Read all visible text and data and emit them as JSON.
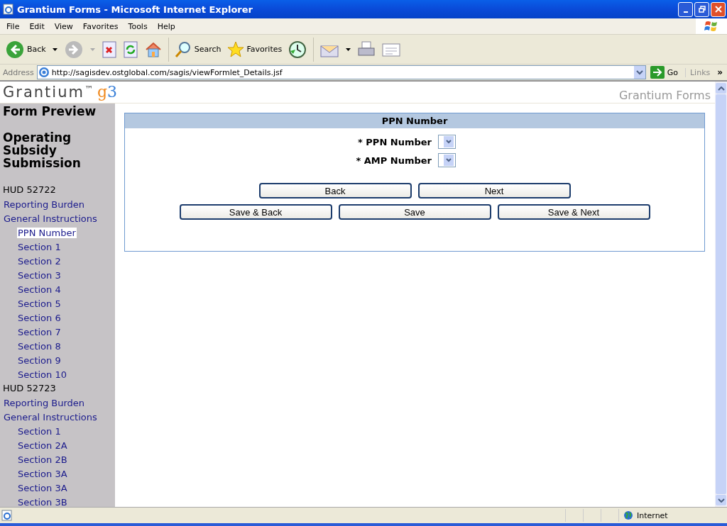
{
  "window": {
    "title": "Grantium Forms - Microsoft Internet Explorer"
  },
  "menu": [
    "File",
    "Edit",
    "View",
    "Favorites",
    "Tools",
    "Help"
  ],
  "toolbar": {
    "back": "Back",
    "search": "Search",
    "favorites": "Favorites"
  },
  "address_bar": {
    "label": "Address",
    "url": "http://sagisdev.ostglobal.com/sagis/viewFormlet_Details.jsf",
    "go": "Go",
    "links": "Links",
    "more": "»"
  },
  "page_header": {
    "brand": "Grantium",
    "trademark": "™",
    "version": "g3",
    "product": "Grantium Forms"
  },
  "sidebar": {
    "title": "Form Preview",
    "form_name": "Operating Subsidy Submission",
    "sections": [
      {
        "heading": "HUD 52722",
        "items": [
          {
            "label": "Reporting Burden",
            "selected": false
          },
          {
            "label": "General Instructions",
            "selected": false,
            "children": [
              {
                "label": "PPN Number",
                "selected": true
              },
              {
                "label": "Section 1",
                "selected": false
              },
              {
                "label": "Section 2",
                "selected": false
              },
              {
                "label": "Section 3",
                "selected": false
              },
              {
                "label": "Section 4",
                "selected": false
              },
              {
                "label": "Section 5",
                "selected": false
              },
              {
                "label": "Section 6",
                "selected": false
              },
              {
                "label": "Section 7",
                "selected": false
              },
              {
                "label": "Section 8",
                "selected": false
              },
              {
                "label": "Section 9",
                "selected": false
              },
              {
                "label": "Section 10",
                "selected": false
              }
            ]
          }
        ]
      },
      {
        "heading": "HUD 52723",
        "items": [
          {
            "label": "Reporting Burden",
            "selected": false
          },
          {
            "label": "General Instructions",
            "selected": false,
            "children": [
              {
                "label": "Section 1",
                "selected": false
              },
              {
                "label": "Section 2A",
                "selected": false
              },
              {
                "label": "Section 2B",
                "selected": false
              },
              {
                "label": "Section 3A",
                "selected": false
              },
              {
                "label": "Section 3A",
                "selected": false
              },
              {
                "label": "Section 3B",
                "selected": false
              }
            ]
          }
        ]
      }
    ]
  },
  "form": {
    "title": "PPN Number",
    "fields": [
      {
        "label": "* PPN Number"
      },
      {
        "label": "* AMP Number"
      }
    ],
    "button_rows": [
      [
        "Back",
        "Next"
      ],
      [
        "Save & Back",
        "Save",
        "Save & Next"
      ]
    ]
  },
  "status_bar": {
    "zone": "Internet"
  }
}
